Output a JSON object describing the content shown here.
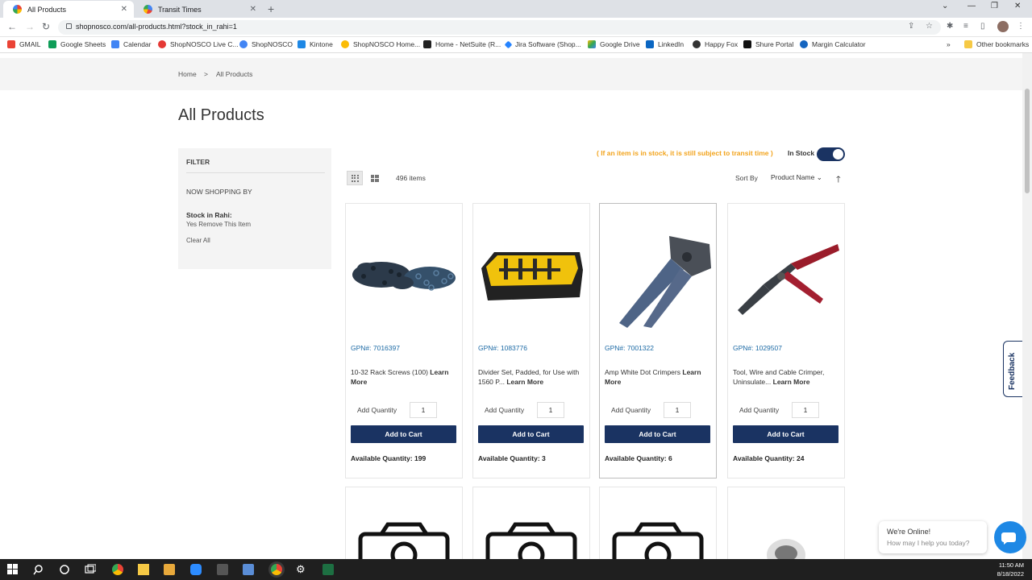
{
  "browser": {
    "tabs": [
      {
        "title": "All Products",
        "active": true
      },
      {
        "title": "Transit Times",
        "active": false
      }
    ],
    "url": "shopnosco.com/all-products.html?stock_in_rahi=1",
    "bookmarks": [
      "GMAIL",
      "Google Sheets",
      "Calendar",
      "ShopNOSCO Live C...",
      "ShopNOSCO",
      "Kintone",
      "ShopNOSCO Home...",
      "Home - NetSuite (R...",
      "Jira Software (Shop...",
      "Google Drive",
      "LinkedIn",
      "Happy Fox",
      "Shure Portal",
      "Margin Calculator"
    ],
    "other_bookmarks": "Other bookmarks"
  },
  "breadcrumb": {
    "home": "Home",
    "sep": ">",
    "current": "All Products"
  },
  "page_title": "All Products",
  "filter": {
    "title": "FILTER",
    "now_shopping": "NOW SHOPPING BY",
    "active_label": "Stock in Rahi:",
    "active_value": "Yes Remove This Item",
    "clear_all": "Clear All"
  },
  "toolbar": {
    "transit_note": "( If an item is in stock, it is still subject to transit time )",
    "in_stock_label": "In Stock",
    "item_count": "496 items",
    "sort_by": "Sort By",
    "sort_value": "Product Name"
  },
  "products": [
    {
      "gpn": "GPN#: 7016397",
      "name": "10-32 Rack Screws (100)",
      "learn": "Learn More",
      "qty_label": "Add Quantity",
      "qty": "1",
      "cart": "Add to Cart",
      "available": "Available Quantity: 199"
    },
    {
      "gpn": "GPN#: 1083776",
      "name": "Divider Set, Padded, for Use with 1560 P...",
      "learn": "Learn More",
      "qty_label": "Add Quantity",
      "qty": "1",
      "cart": "Add to Cart",
      "available": "Available Quantity: 3"
    },
    {
      "gpn": "GPN#: 7001322",
      "name": "Amp White Dot Crimpers",
      "learn": "Learn More",
      "qty_label": "Add Quantity",
      "qty": "1",
      "cart": "Add to Cart",
      "available": "Available Quantity: 6"
    },
    {
      "gpn": "GPN#: 1029507",
      "name": "Tool, Wire and Cable Crimper, Uninsulate...",
      "learn": "Learn More",
      "qty_label": "Add Quantity",
      "qty": "1",
      "cart": "Add to Cart",
      "available": "Available Quantity: 24"
    }
  ],
  "feedback": "Feedback",
  "chat": {
    "title": "We're Online!",
    "subtitle": "How may I help you today?"
  },
  "clock": {
    "time": "11:50 AM",
    "date": "8/18/2022"
  },
  "colors": {
    "brand_navy": "#1a3362",
    "transit_orange": "#f2a31b",
    "gpn_blue": "#1c6aa5"
  }
}
